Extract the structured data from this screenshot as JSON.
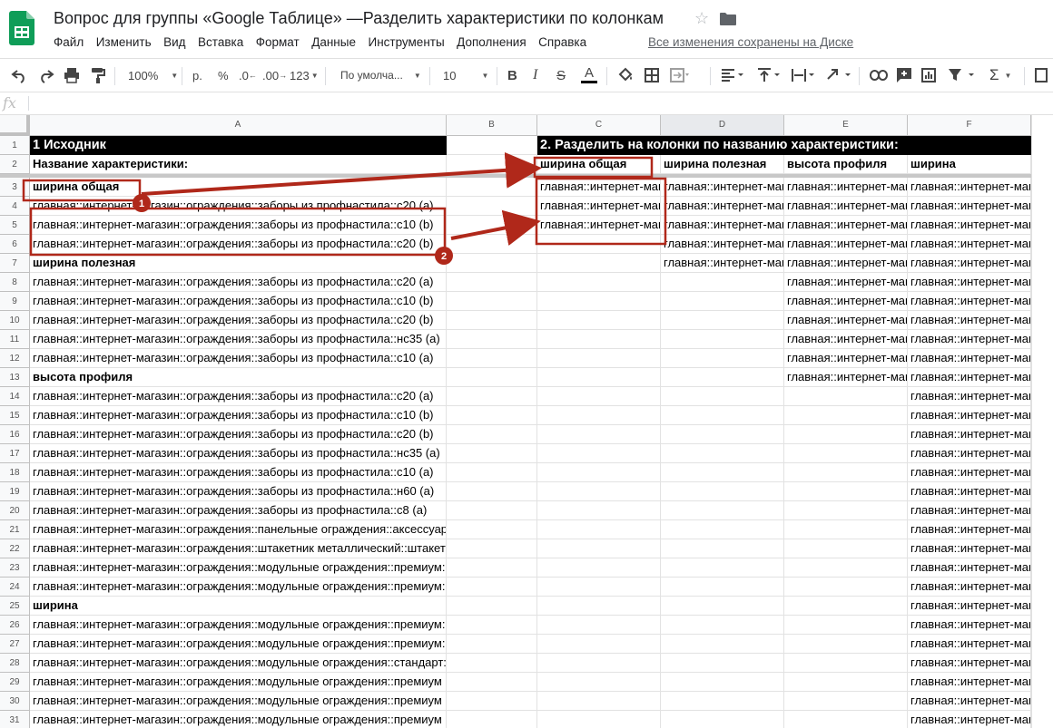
{
  "app": {
    "title": "Вопрос для группы «Google Таблице»  —Разделить характеристики по колонкам",
    "saved_status": "Все изменения сохранены на Диске",
    "logo_color": "#0f9d58"
  },
  "menu": [
    "Файл",
    "Изменить",
    "Вид",
    "Вставка",
    "Формат",
    "Данные",
    "Инструменты",
    "Дополнения",
    "Справка"
  ],
  "toolbar": {
    "zoom": "100%",
    "currency": "р.",
    "percent": "%",
    "decrease_decimals": ".0",
    "increase_decimals": ".00",
    "more_formats": "123",
    "font": "По умолча...",
    "font_size": "10",
    "bold": "B",
    "strike": "S",
    "text_color": "A",
    "sum": "Σ"
  },
  "formula_bar": {
    "fx": "fx"
  },
  "columns": [
    "A",
    "B",
    "C",
    "D",
    "E",
    "F"
  ],
  "rows": [
    "1",
    "2",
    "3",
    "4",
    "5",
    "6",
    "7",
    "8",
    "9",
    "10",
    "11",
    "12",
    "13",
    "14",
    "15",
    "16",
    "17",
    "18",
    "19",
    "20",
    "21",
    "22",
    "23",
    "24",
    "25",
    "26",
    "27",
    "28",
    "29",
    "30",
    "31"
  ],
  "sheet": {
    "a1": "1 Исходник",
    "c1": "2. Разделить на колонки по названию характеристики:",
    "a2": "Название характеристики:",
    "c2": "ширина общая",
    "d2": "ширина полезная",
    "e2": "высота профиля",
    "f2": "ширина",
    "col_a": [
      "ширина общая",
      "главная::интернет-магазин::ограждения::заборы из профнастила::с20 (а)",
      "главная::интернет-магазин::ограждения::заборы из профнастила::с10 (b)",
      "главная::интернет-магазин::ограждения::заборы из профнастила::с20 (b)",
      "ширина полезная",
      "главная::интернет-магазин::ограждения::заборы из профнастила::с20 (а)",
      "главная::интернет-магазин::ограждения::заборы из профнастила::с10 (b)",
      "главная::интернет-магазин::ограждения::заборы из профнастила::с20 (b)",
      "главная::интернет-магазин::ограждения::заборы из профнастила::нс35 (а)",
      "главная::интернет-магазин::ограждения::заборы из профнастила::с10 (а)",
      "высота профиля",
      "главная::интернет-магазин::ограждения::заборы из профнастила::с20 (а)",
      "главная::интернет-магазин::ограждения::заборы из профнастила::с10 (b)",
      "главная::интернет-магазин::ограждения::заборы из профнастила::с20 (b)",
      "главная::интернет-магазин::ограждения::заборы из профнастила::нс35 (а)",
      "главная::интернет-магазин::ограждения::заборы из профнастила::с10 (а)",
      "главная::интернет-магазин::ограждения::заборы из профнастила::н60 (а)",
      "главная::интернет-магазин::ограждения::заборы из профнастила::с8 (а)",
      "главная::интернет-магазин::ограждения::панельные ограждения::аксессуар",
      "главная::интернет-магазин::ограждения::штакетник металлический::штакет",
      "главная::интернет-магазин::ограждения::модульные ограждения::премиум:",
      "главная::интернет-магазин::ограждения::модульные ограждения::премиум:",
      "ширина",
      "главная::интернет-магазин::ограждения::модульные ограждения::премиум:",
      "главная::интернет-магазин::ограждения::модульные ограждения::премиум:",
      "главная::интернет-магазин::ограждения::модульные ограждения::стандарт:",
      "главная::интернет-магазин::ограждения::модульные ограждения::премиум",
      "главная::интернет-магазин::ограждения::модульные ограждения::премиум",
      "главная::интернет-магазин::ограждения::модульные ограждения::премиум"
    ],
    "split_cell_text": "главная::интернет-магазин::ограждения::заборы из профнастила",
    "col_c_filled_rows": 3,
    "col_d_filled_rows": 5,
    "col_e_filled_rows": 11,
    "col_f_filled_rows": 29
  },
  "annotations": {
    "color": "#b0281a",
    "badge_1": "1",
    "badge_2": "2"
  }
}
